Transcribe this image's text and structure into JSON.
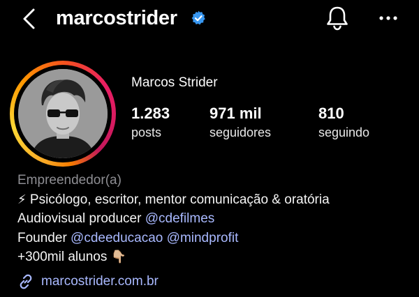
{
  "header": {
    "username": "marcostrider",
    "icons": {
      "back": "chevron-left-icon",
      "verified": "verified-badge-icon",
      "notifications": "bell-icon",
      "more": "more-horizontal-icon"
    }
  },
  "profile": {
    "display_name": "Marcos Strider",
    "stats": {
      "posts": {
        "value": "1.283",
        "label": "posts"
      },
      "followers": {
        "value": "971 mil",
        "label": "seguidores"
      },
      "following": {
        "value": "810",
        "label": "seguindo"
      }
    }
  },
  "bio": {
    "category": "Empreendedor(a)",
    "line1_emoji": "⚡",
    "line1_text": " Psicólogo, escritor, mentor comunicação & oratória",
    "line2_text": "Audiovisual producer ",
    "line2_mention": "@cdefilmes",
    "line3_text": "Founder ",
    "line3_mention1": "@cdeeducacao",
    "line3_mention2": "@mindprofit",
    "line4_text": "+300mil alunos ",
    "line4_emoji": "👇🏼",
    "link": "marcostrider.com.br"
  },
  "colors": {
    "background": "#000000",
    "text": "#f5f5f5",
    "muted": "#8e8e93",
    "mention": "#a9b9ff",
    "verified": "#3897f0"
  }
}
